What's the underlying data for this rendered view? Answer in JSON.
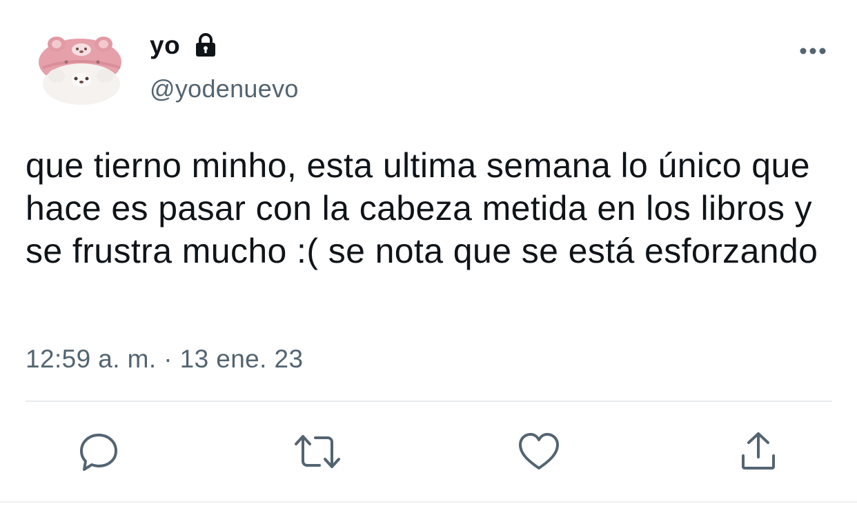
{
  "tweet": {
    "display_name": "yo",
    "handle": "@yodenuevo",
    "protected_icon": "lock-icon",
    "text": "que tierno minho, esta ultima semana lo único que hace es pasar con la cabeza metida en los libros y se frustra mucho :( se nota que se está esforzando",
    "timestamp": "12:59 a. m. · 13 ene. 23",
    "avatar": "avatar-image",
    "more_icon": "more-dots-icon"
  },
  "actions": [
    {
      "name": "reply",
      "icon": "reply-icon"
    },
    {
      "name": "retweet",
      "icon": "retweet-icon"
    },
    {
      "name": "like",
      "icon": "heart-icon"
    },
    {
      "name": "share",
      "icon": "share-icon"
    }
  ],
  "colors": {
    "text_primary": "#0f1419",
    "text_secondary": "#536471",
    "icon_gray": "#536471",
    "divider": "#e7eaed",
    "avatar_pink": "#e7a3ad",
    "avatar_white": "#f4f1ef"
  }
}
